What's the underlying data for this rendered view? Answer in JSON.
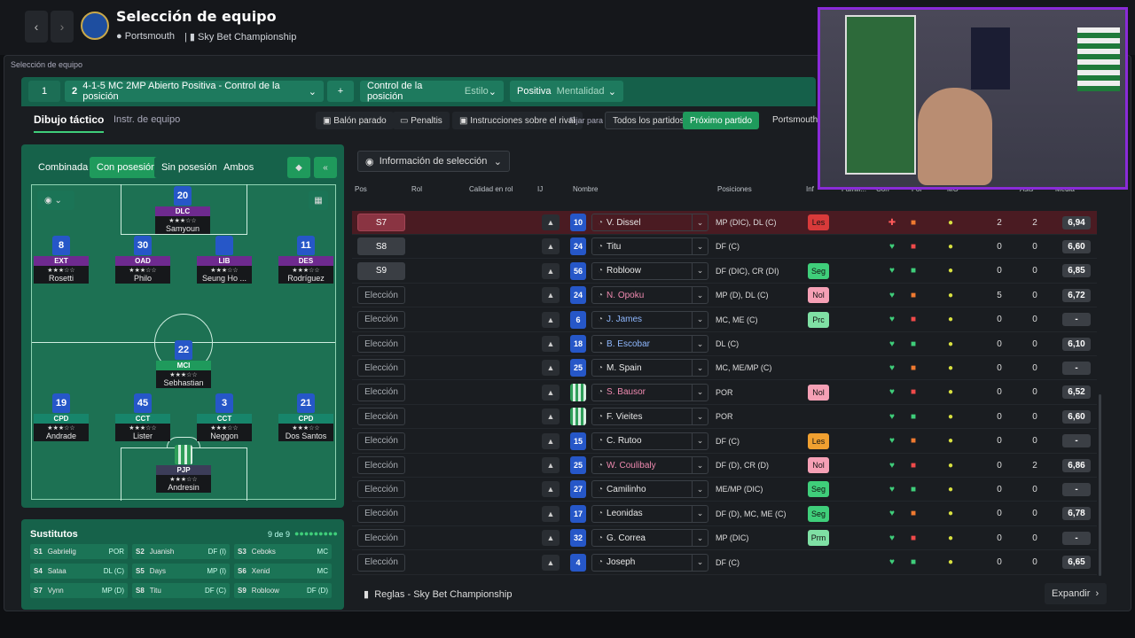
{
  "header": {
    "title": "Selección de equipo",
    "club": "Portsmouth",
    "league": "Sky Bet Championship"
  },
  "breadcrumb": "Selección de equipo",
  "tactic": {
    "slot": "1",
    "number": "2",
    "name": "4-1-5 MC 2MP Abierto Positiva - Control de la posición",
    "add": "+",
    "style_label": "Control de la posición",
    "style_sub": "Estilo",
    "mentality_label": "Positiva",
    "mentality_sub": "Mentalidad"
  },
  "tabs": {
    "drawing": "Dibujo táctico",
    "instructions": "Instr. de equipo"
  },
  "toolbar": {
    "set_pieces": "Balón parado",
    "penalties": "Penaltis",
    "opp_instr": "Instrucciones sobre el rival",
    "fix_for": "Fijar para",
    "all_matches": "Todos los partidos",
    "next_match": "Próximo partido",
    "club": "Portsmouth"
  },
  "pitch_tabs": [
    "Combinada",
    "Con posesión",
    "Sin posesión",
    "Ambos"
  ],
  "selection_info": "Información de selección",
  "players_on_pitch": [
    {
      "num": "20",
      "pos": "DLC",
      "name": "Samyoun"
    },
    {
      "num": "8",
      "pos": "EXT",
      "name": "Rosetti"
    },
    {
      "num": "30",
      "pos": "OAD",
      "name": "Philo"
    },
    {
      "num": "",
      "pos": "LIB",
      "name": "Seung Ho ..."
    },
    {
      "num": "11",
      "pos": "DES",
      "name": "Rodríguez"
    },
    {
      "num": "22",
      "pos": "MCI",
      "name": "Sebhastian"
    },
    {
      "num": "19",
      "pos": "CPD",
      "name": "Andrade"
    },
    {
      "num": "45",
      "pos": "CCT",
      "name": "Lister"
    },
    {
      "num": "3",
      "pos": "CCT",
      "name": "Neggon"
    },
    {
      "num": "21",
      "pos": "CPD",
      "name": "Dos Santos"
    },
    {
      "num": "",
      "pos": "PJP",
      "name": "Andresin"
    }
  ],
  "subs": {
    "title": "Sustitutos",
    "count": "9 de 9",
    "items": [
      {
        "slot": "S1",
        "name": "Gabrielig",
        "pos": "POR"
      },
      {
        "slot": "S2",
        "name": "Juanish",
        "pos": "DF (I)"
      },
      {
        "slot": "S3",
        "name": "Ceboks",
        "pos": "MC"
      },
      {
        "slot": "S4",
        "name": "Sataa",
        "pos": "DL (C)"
      },
      {
        "slot": "S5",
        "name": "Days",
        "pos": "MP (I)"
      },
      {
        "slot": "S6",
        "name": "Xenid",
        "pos": "MC"
      },
      {
        "slot": "S7",
        "name": "Vynn",
        "pos": "MP (D)"
      },
      {
        "slot": "S8",
        "name": "Titu",
        "pos": "DF (C)"
      },
      {
        "slot": "S9",
        "name": "Robloow",
        "pos": "DF (D)"
      }
    ]
  },
  "columns": [
    "Pos",
    "Rol",
    "Calidad en rol",
    "IJ",
    "Nombre",
    "Posiciones",
    "Inf",
    "Famili...",
    "Con",
    "For",
    "MO",
    "Asis",
    "Media"
  ],
  "rows": [
    {
      "sel": "S7",
      "num": "10",
      "name": "V. Dissel",
      "pos": "MP (DIC), DL (C)",
      "tag": "Les",
      "tagc": "#d83a3a",
      "g": "2",
      "a": "2",
      "avg": "6,94"
    },
    {
      "sel": "S8",
      "num": "24",
      "name": "Titu",
      "pos": "DF (C)",
      "tag": "",
      "tagc": "",
      "g": "0",
      "a": "0",
      "avg": "6,60"
    },
    {
      "sel": "S9",
      "num": "56",
      "name": "Robloow",
      "pos": "DF (DIC), CR (DI)",
      "tag": "Seg",
      "tagc": "#3fce7a",
      "g": "0",
      "a": "0",
      "avg": "6,85"
    },
    {
      "sel": "Elección",
      "num": "24",
      "name": "N. Opoku",
      "pos": "MP (D), DL (C)",
      "tag": "Nol",
      "tagc": "#f5a0b5",
      "g": "5",
      "a": "0",
      "avg": "6,72"
    },
    {
      "sel": "Elección",
      "num": "6",
      "name": "J. James",
      "pos": "MC, ME (C)",
      "tag": "Prc",
      "tagc": "#7fe0a4",
      "g": "0",
      "a": "0",
      "avg": "-"
    },
    {
      "sel": "Elección",
      "num": "18",
      "name": "B. Escobar",
      "pos": "DL (C)",
      "tag": "",
      "tagc": "",
      "g": "0",
      "a": "0",
      "avg": "6,10"
    },
    {
      "sel": "Elección",
      "num": "25",
      "name": "M. Spain",
      "pos": "MC, ME/MP (C)",
      "tag": "",
      "tagc": "",
      "g": "0",
      "a": "0",
      "avg": "-"
    },
    {
      "sel": "Elección",
      "num": "",
      "name": "S. Bausor",
      "pos": "POR",
      "tag": "Nol",
      "tagc": "#f5a0b5",
      "g": "0",
      "a": "0",
      "avg": "6,52"
    },
    {
      "sel": "Elección",
      "num": "",
      "name": "F. Vieites",
      "pos": "POR",
      "tag": "",
      "tagc": "",
      "g": "0",
      "a": "0",
      "avg": "6,60"
    },
    {
      "sel": "Elección",
      "num": "15",
      "name": "C. Rutoo",
      "pos": "DF (C)",
      "tag": "Les",
      "tagc": "#f0a030",
      "g": "0",
      "a": "0",
      "avg": "-"
    },
    {
      "sel": "Elección",
      "num": "25",
      "name": "W. Coulibaly",
      "pos": "DF (D), CR (D)",
      "tag": "Nol",
      "tagc": "#f5a0b5",
      "g": "0",
      "a": "2",
      "avg": "6,86"
    },
    {
      "sel": "Elección",
      "num": "27",
      "name": "Camilinho",
      "pos": "ME/MP (DIC)",
      "tag": "Seg",
      "tagc": "#3fce7a",
      "g": "0",
      "a": "0",
      "avg": "-"
    },
    {
      "sel": "Elección",
      "num": "17",
      "name": "Leonidas",
      "pos": "DF (D), MC, ME (C)",
      "tag": "Seg",
      "tagc": "#3fce7a",
      "g": "0",
      "a": "0",
      "avg": "6,78"
    },
    {
      "sel": "Elección",
      "num": "32",
      "name": "G. Correa",
      "pos": "MP (DIC)",
      "tag": "Prm",
      "tagc": "#7fe0a4",
      "g": "0",
      "a": "0",
      "avg": "-"
    },
    {
      "sel": "Elección",
      "num": "4",
      "name": "Joseph",
      "pos": "DF (C)",
      "tag": "",
      "tagc": "",
      "g": "0",
      "a": "0",
      "avg": "6,65"
    }
  ],
  "footer": {
    "rules": "Reglas - Sky Bet Championship",
    "expand": "Expandir"
  }
}
